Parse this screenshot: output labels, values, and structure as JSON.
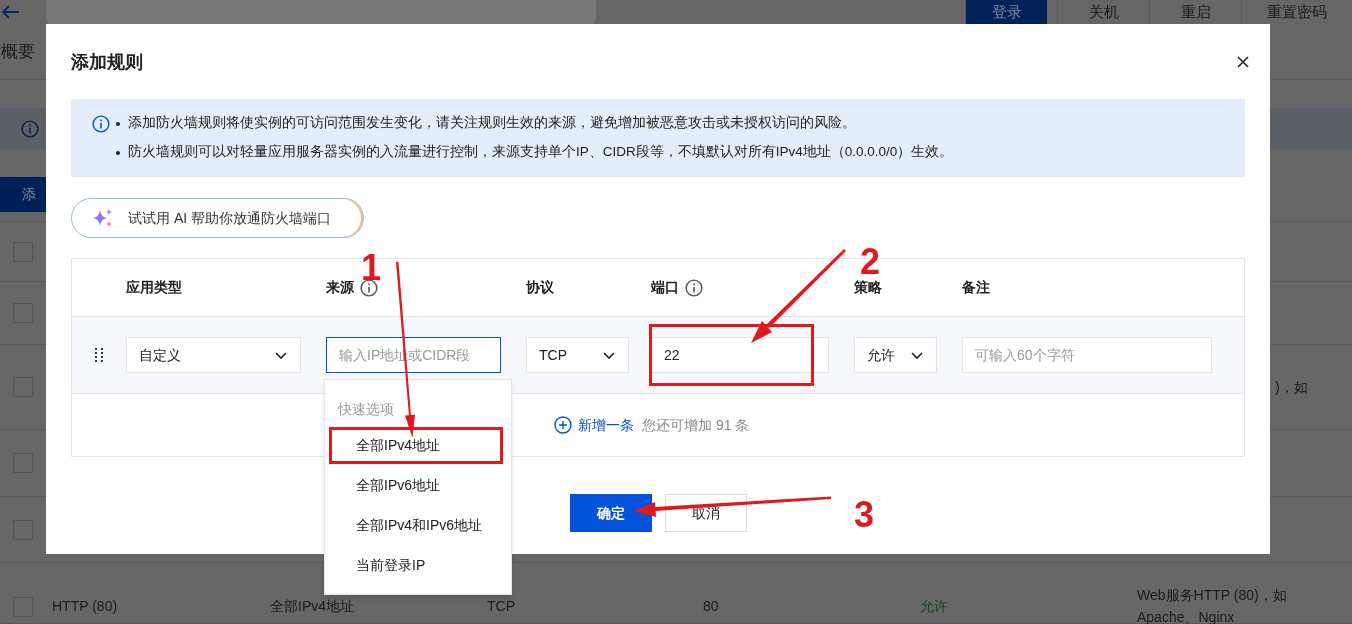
{
  "background": {
    "top_buttons": [
      {
        "label": "登录",
        "primary": true
      },
      {
        "label": "关机",
        "primary": false
      },
      {
        "label": "重启",
        "primary": false
      },
      {
        "label": "重置密码",
        "primary": false
      }
    ],
    "tab": "概要",
    "add_button": "添",
    "rows": [
      {
        "checked": false
      },
      {
        "checked": false
      },
      {
        "checked": false,
        "note": ")，如"
      },
      {
        "checked": false
      },
      {
        "checked": false
      },
      {
        "checked": false,
        "app_type": "HTTP (80)",
        "source": "全部IPv4地址",
        "protocol": "TCP",
        "port": "80",
        "policy": "允许",
        "note": "Web服务HTTP (80)，如 Apache、Nginx"
      }
    ]
  },
  "dialog": {
    "title": "添加规则",
    "notices": [
      "添加防火墙规则将使实例的可访问范围发生变化，请关注规则生效的来源，避免增加被恶意攻击或未授权访问的风险。",
      "防火墙规则可以对轻量应用服务器实例的入流量进行控制，来源支持单个IP、CIDR段等，不填默认对所有IPv4地址（0.0.0.0/0）生效。"
    ],
    "ai_button": "试试用 AI 帮助你放通防火墙端口",
    "columns": [
      {
        "label": "应用类型",
        "info": false
      },
      {
        "label": "来源",
        "info": true
      },
      {
        "label": "协议",
        "info": false
      },
      {
        "label": "端口",
        "info": true
      },
      {
        "label": "策略",
        "info": false
      },
      {
        "label": "备注",
        "info": false
      }
    ],
    "rule": {
      "app_type": "自定义",
      "source": {
        "placeholder": "输入IP地址或CIDR段",
        "focused": true
      },
      "protocol": "TCP",
      "port": "22",
      "policy": "允许",
      "note": {
        "placeholder": "可输入60个字符"
      }
    },
    "add_row": "新增一条",
    "remaining": "您还可增加 91 条",
    "buttons": [
      {
        "label": "确定",
        "primary": true
      },
      {
        "label": "取消",
        "primary": false
      }
    ]
  },
  "quick_options": {
    "header": "快速选项",
    "items": [
      "全部IPv4地址",
      "全部IPv6地址",
      "全部IPv4和IPv6地址",
      "当前登录IP"
    ]
  },
  "annotations": [
    {
      "label": "1"
    },
    {
      "label": "2"
    },
    {
      "label": "3"
    }
  ]
}
